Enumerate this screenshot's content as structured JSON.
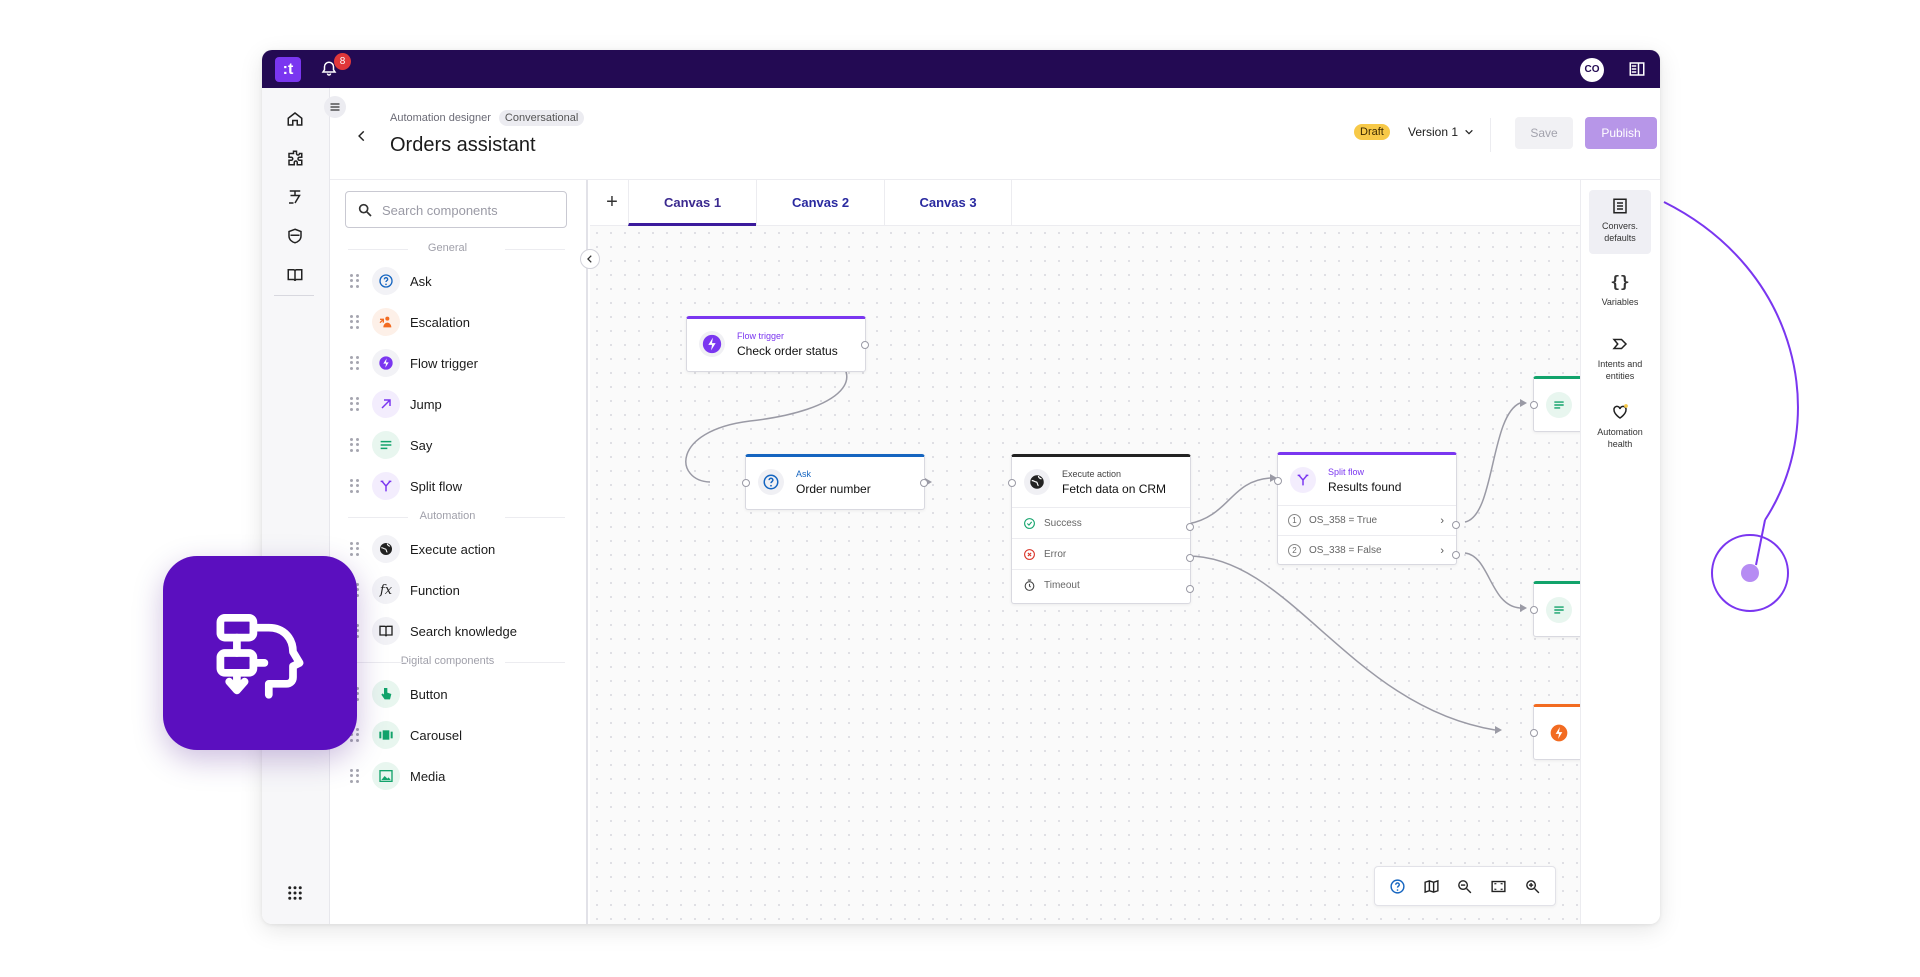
{
  "topbar": {
    "logo_text": ":t",
    "notifications_count": "8",
    "avatar_initials": "CO"
  },
  "header": {
    "breadcrumb": "Automation designer",
    "breadcrumb_tag": "Conversational",
    "title": "Orders assistant",
    "status_badge": "Draft",
    "version_label": "Version 1",
    "save_label": "Save",
    "publish_label": "Publish",
    "more_label": "•••"
  },
  "components": {
    "search_placeholder": "Search components",
    "sections": {
      "general": "General",
      "automation": "Automation",
      "digital": "Digital components"
    },
    "items": [
      {
        "label": "Ask",
        "icon": "question-icon"
      },
      {
        "label": "Escalation",
        "icon": "escalation-icon"
      },
      {
        "label": "Flow trigger",
        "icon": "lightning-icon"
      },
      {
        "label": "Jump",
        "icon": "arrow-up-right-icon"
      },
      {
        "label": "Say",
        "icon": "text-lines-icon"
      },
      {
        "label": "Split flow",
        "icon": "split-icon"
      },
      {
        "label": "Execute action",
        "icon": "globe-icon"
      },
      {
        "label": "Function",
        "icon": "function-icon"
      },
      {
        "label": "Search knowledge",
        "icon": "book-icon"
      },
      {
        "label": "Button",
        "icon": "pointer-icon"
      },
      {
        "label": "Carousel",
        "icon": "carousel-icon"
      },
      {
        "label": "Media",
        "icon": "image-icon"
      }
    ]
  },
  "canvas": {
    "add_tab": "+",
    "tabs": [
      {
        "label": "Canvas 1",
        "active": true
      },
      {
        "label": "Canvas 2",
        "active": false
      },
      {
        "label": "Canvas 3",
        "active": false
      }
    ],
    "nodes": {
      "flow_trigger": {
        "type": "Flow trigger",
        "name": "Check order status",
        "color": "#7a36f0"
      },
      "ask": {
        "type": "Ask",
        "name": "Order number",
        "color": "#1565c0"
      },
      "execute": {
        "type": "Execute action",
        "name": "Fetch data on CRM",
        "color": "#222222",
        "outcomes": [
          "Success",
          "Error",
          "Timeout"
        ]
      },
      "split": {
        "type": "Split flow",
        "name": "Results found",
        "color": "#7a36f0",
        "conditions": [
          {
            "num": "1",
            "label": "OS_358 = True"
          },
          {
            "num": "2",
            "label": "OS_338 = False"
          }
        ]
      }
    }
  },
  "right_panel": {
    "items": [
      {
        "label": "Convers. defaults",
        "icon": "list-icon",
        "active": true
      },
      {
        "label": "Variables",
        "icon": "braces-icon",
        "active": false
      },
      {
        "label": "Intents and entities",
        "icon": "intent-icon",
        "active": false
      },
      {
        "label": "Automation health",
        "icon": "heart-icon",
        "active": false
      }
    ]
  },
  "colors": {
    "brand_dark": "#230a53",
    "brand_purple": "#5b0fbf",
    "accent": "#7a36f0",
    "green": "#12a36b",
    "orange": "#f26b21"
  }
}
